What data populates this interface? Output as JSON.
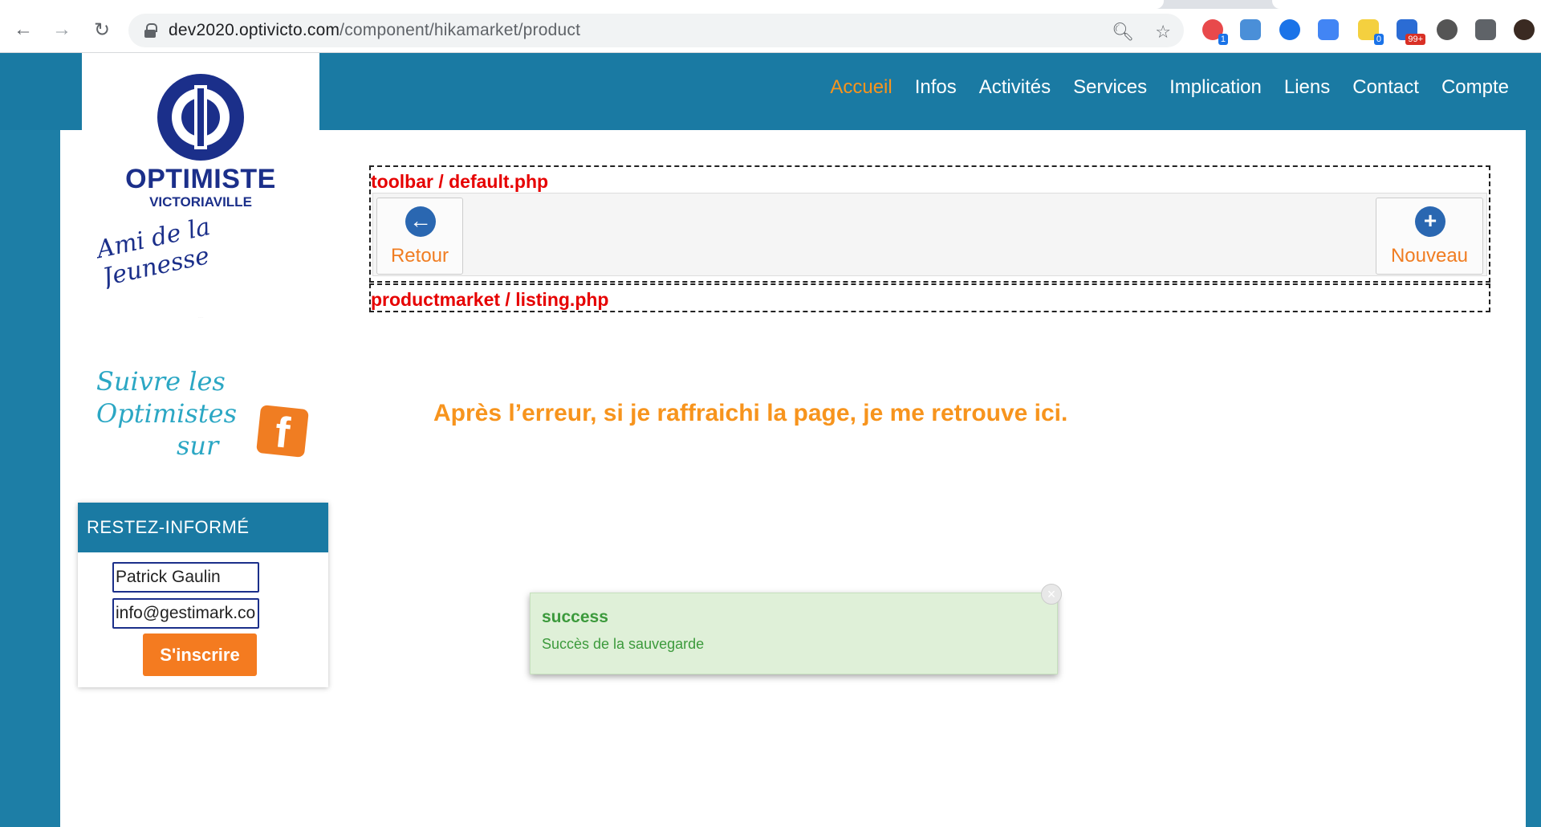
{
  "browser": {
    "url_host": "dev2020.optivicto.com",
    "url_path": "/component/hikamarket/product",
    "extension_badges": [
      "1",
      "0",
      "99+"
    ]
  },
  "site": {
    "logo": {
      "title": "OPTIMISTE",
      "subtitle": "VICTORIAVILLE",
      "tagline": "Ami de la Jeunesse"
    },
    "nav": [
      {
        "label": "Accueil",
        "active": true
      },
      {
        "label": "Infos"
      },
      {
        "label": "Activités"
      },
      {
        "label": "Services"
      },
      {
        "label": "Implication"
      },
      {
        "label": "Liens"
      },
      {
        "label": "Contact"
      },
      {
        "label": "Compte"
      }
    ],
    "facebook_promo": {
      "line1": "Suivre les",
      "line2": "Optimistes",
      "line3": "sur",
      "fb_glyph": "f"
    },
    "newsletter": {
      "header": "RESTEZ-INFORMÉ",
      "name_value": "Patrick Gaulin",
      "email_value": "info@gestimark.co",
      "submit_label": "S'inscrire"
    }
  },
  "debug": {
    "toolbar_label": "toolbar / default.php",
    "listing_label": "productmarket / listing.php"
  },
  "toolbar": {
    "back_label": "Retour",
    "new_label": "Nouveau"
  },
  "main_message": "Après l’erreur, si je raffraichi la page, je me retrouve ici.",
  "toast": {
    "title": "success",
    "message": "Succès de la sauvegarde"
  },
  "colors": {
    "brand_blue": "#1a7aa3",
    "accent_orange": "#f7941d",
    "debug_red": "#e60000",
    "success_bg": "#dff0d8"
  }
}
